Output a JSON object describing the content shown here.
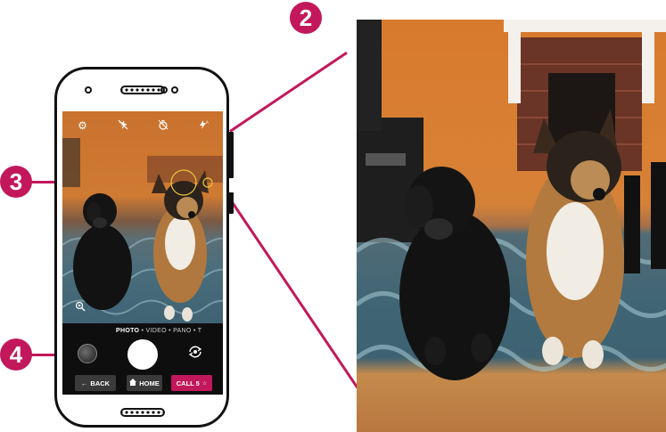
{
  "callouts": {
    "c2": "2",
    "c3": "3",
    "c4": "4"
  },
  "camera": {
    "modes": {
      "photo": "PHOTO",
      "sep1": "•",
      "video": "VIDEO",
      "sep2": "•",
      "pano": "PANO",
      "sep3": "•",
      "t": "T"
    }
  },
  "navbar": {
    "back_label": "BACK",
    "home_label": "HOME",
    "call_label": "CALL 5",
    "call_superscript": "☆"
  },
  "colors": {
    "accent": "#c2185b",
    "phone_outline": "#111111"
  },
  "icons": {
    "settings": "gear-icon",
    "flash_off": "flash-off-icon",
    "timer": "timer-icon",
    "flash_auto": "flash-auto-icon",
    "zoom": "zoom-in-icon",
    "switch_camera": "switch-camera-icon",
    "back": "arrow-left-icon",
    "home": "home-icon"
  }
}
